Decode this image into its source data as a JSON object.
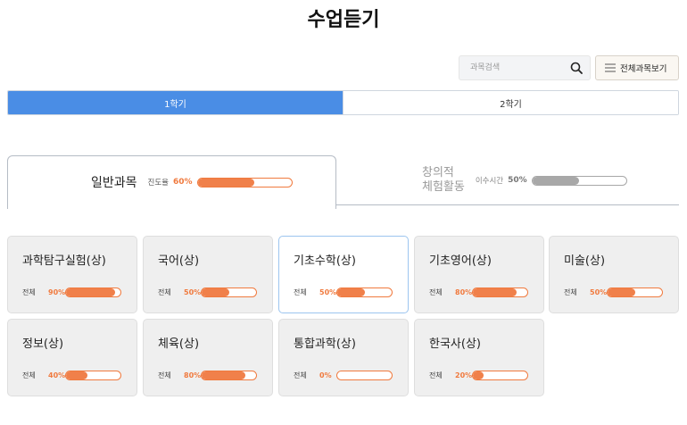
{
  "page": {
    "title": "수업듣기"
  },
  "search": {
    "placeholder": "과목검색"
  },
  "toolbar": {
    "all_courses_label": "전체과목보기"
  },
  "semester_tabs": [
    {
      "label": "1학기",
      "active": true
    },
    {
      "label": "2학기",
      "active": false
    }
  ],
  "category_tabs": [
    {
      "label": "일반과목",
      "progress_label": "진도율",
      "percent_text": "60%",
      "progress": 60,
      "active": true
    },
    {
      "label_line1": "창의적",
      "label_line2": "체험활동",
      "progress_label": "이수시간",
      "percent_text": "50%",
      "progress": 50,
      "active": false
    }
  ],
  "courses": [
    {
      "title": "과학탐구실험(상)",
      "all_label": "전체",
      "percent_text": "90%",
      "progress": 90
    },
    {
      "title": "국어(상)",
      "all_label": "전체",
      "percent_text": "50%",
      "progress": 50
    },
    {
      "title": "기초수학(상)",
      "all_label": "전체",
      "percent_text": "50%",
      "progress": 50,
      "selected": true
    },
    {
      "title": "기초영어(상)",
      "all_label": "전체",
      "percent_text": "80%",
      "progress": 80
    },
    {
      "title": "미술(상)",
      "all_label": "전체",
      "percent_text": "50%",
      "progress": 50
    },
    {
      "title": "정보(상)",
      "all_label": "전체",
      "percent_text": "40%",
      "progress": 40
    },
    {
      "title": "체육(상)",
      "all_label": "전체",
      "percent_text": "80%",
      "progress": 80
    },
    {
      "title": "통합과학(상)",
      "all_label": "전체",
      "percent_text": "0%",
      "progress": 0
    },
    {
      "title": "한국사(상)",
      "all_label": "전체",
      "percent_text": "20%",
      "progress": 20
    }
  ],
  "colors": {
    "accent_blue": "#4a8de5",
    "progress_orange": "#f0804a",
    "progress_gray": "#a8a8a8"
  },
  "icons": {
    "search": "search-icon",
    "menu": "menu-icon"
  }
}
